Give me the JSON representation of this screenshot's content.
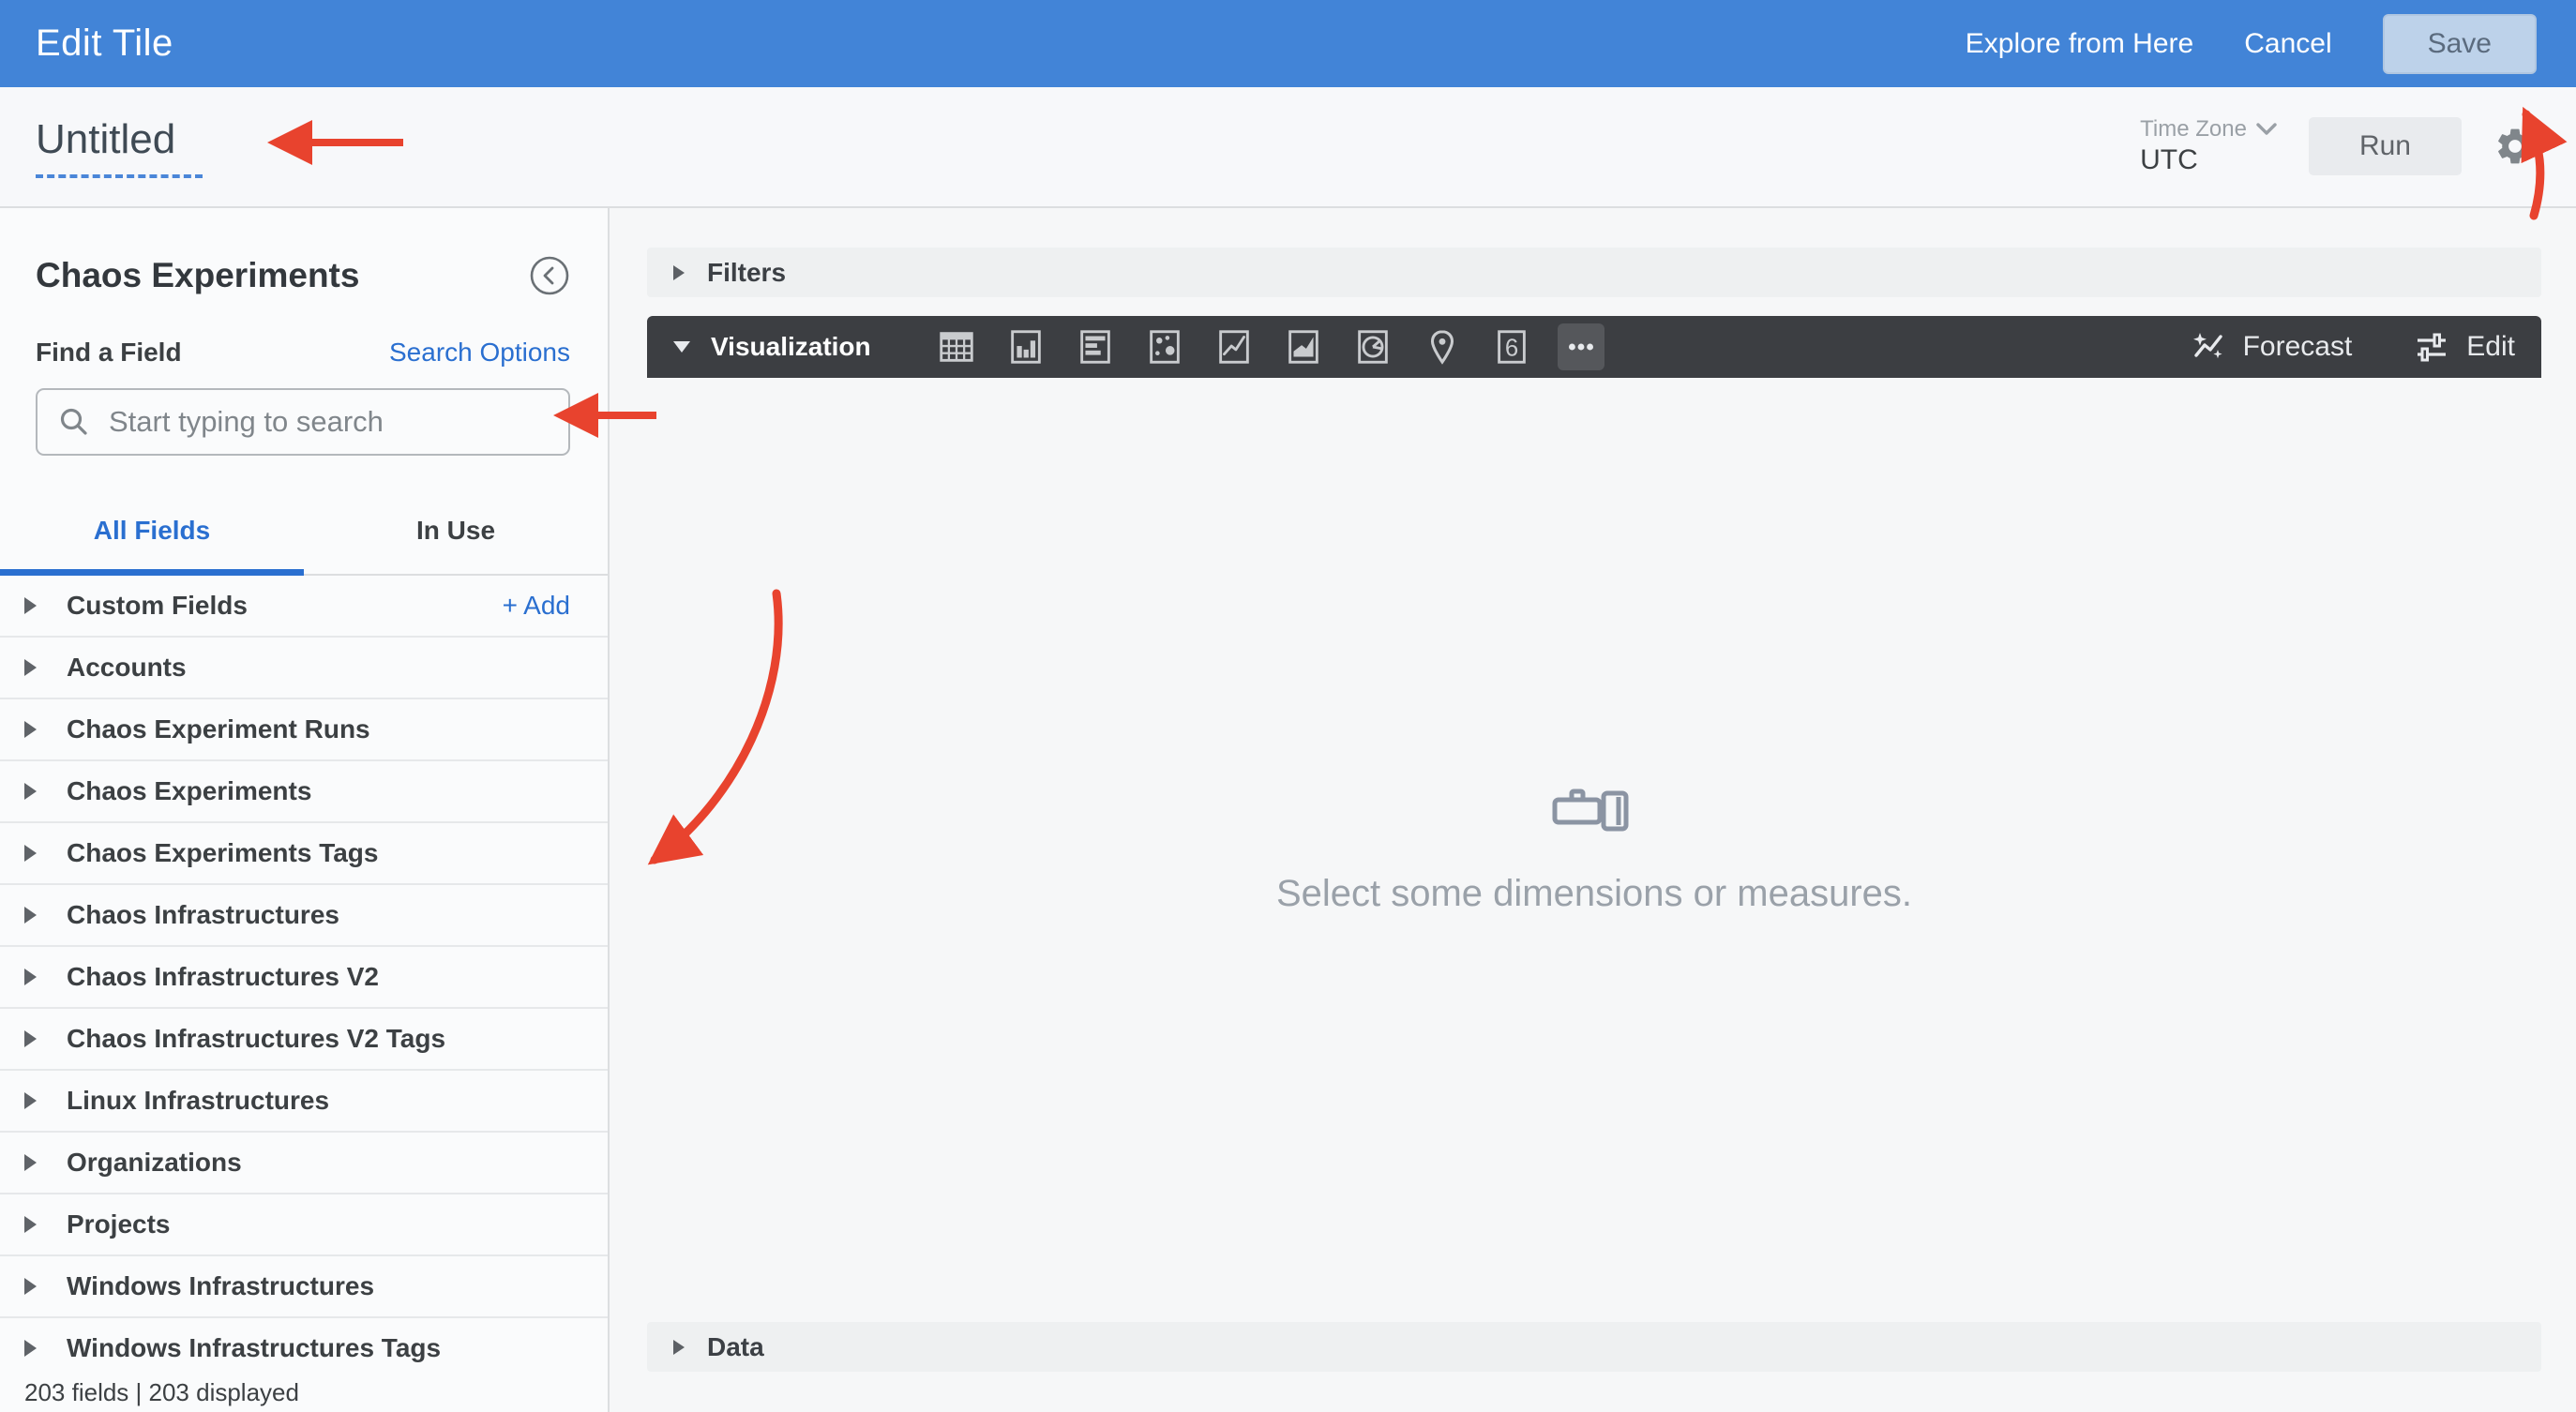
{
  "topbar": {
    "title": "Edit Tile",
    "explore_label": "Explore from Here",
    "cancel_label": "Cancel",
    "save_label": "Save"
  },
  "header": {
    "title": "Untitled",
    "timezone_label": "Time Zone",
    "timezone_value": "UTC",
    "run_label": "Run"
  },
  "sidebar": {
    "title": "Chaos Experiments",
    "find_label": "Find a Field",
    "search_options_label": "Search Options",
    "search_placeholder": "Start typing to search",
    "tabs": [
      {
        "label": "All Fields",
        "active": true
      },
      {
        "label": "In Use",
        "active": false
      }
    ],
    "custom_fields": {
      "label": "Custom Fields",
      "add_label": "+ Add"
    },
    "fields": [
      "Accounts",
      "Chaos Experiment Runs",
      "Chaos Experiments",
      "Chaos Experiments Tags",
      "Chaos Infrastructures",
      "Chaos Infrastructures V2",
      "Chaos Infrastructures V2 Tags",
      "Linux Infrastructures",
      "Organizations",
      "Projects",
      "Windows Infrastructures",
      "Windows Infrastructures Tags"
    ],
    "footer": "203 fields | 203 displayed"
  },
  "main": {
    "filters_label": "Filters",
    "visualization_label": "Visualization",
    "viz_icons": [
      "table",
      "column-chart",
      "bar-chart",
      "scatter-chart",
      "line-chart",
      "area-chart",
      "pie-chart",
      "map-pin",
      "single-value",
      "more"
    ],
    "forecast_label": "Forecast",
    "edit_label": "Edit",
    "empty_state_message": "Select some dimensions or measures.",
    "data_label": "Data"
  },
  "colors": {
    "topbar_blue": "#4284d7",
    "accent_blue": "#2a6fd0",
    "viz_bar_dark": "#3c3e42",
    "annotation_red": "#e8432e"
  }
}
